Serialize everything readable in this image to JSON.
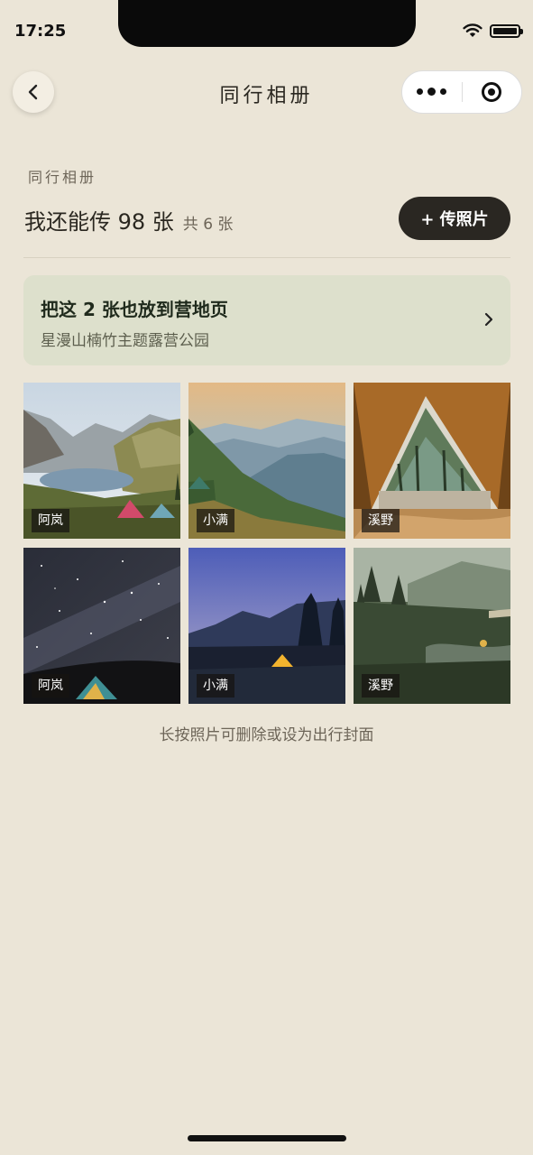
{
  "status": {
    "time": "17:25"
  },
  "nav": {
    "title": "同行相册"
  },
  "album": {
    "section_label": "同行相册",
    "quota_text": "我还能传 98 张",
    "total_text": "共 6 张",
    "upload_label": "+ 传照片"
  },
  "banner": {
    "title": "把这 2 张也放到营地页",
    "subtitle": "星漫山楠竹主题露营公园"
  },
  "photos": [
    {
      "author": "阿岚",
      "scene": "alpine-lake-tents"
    },
    {
      "author": "小满",
      "scene": "misty-mountain-sunrise"
    },
    {
      "author": "溪野",
      "scene": "tent-doorway-forest"
    },
    {
      "author": "阿岚",
      "scene": "milky-way-tent"
    },
    {
      "author": "小满",
      "scene": "dusk-glowing-tent"
    },
    {
      "author": "溪野",
      "scene": "foggy-forest-camp"
    }
  ],
  "hint": "长按照片可删除或设为出行封面",
  "colors": {
    "background": "#ebe5d7",
    "primary_button": "#2a2722",
    "banner": "#dde0cc"
  }
}
